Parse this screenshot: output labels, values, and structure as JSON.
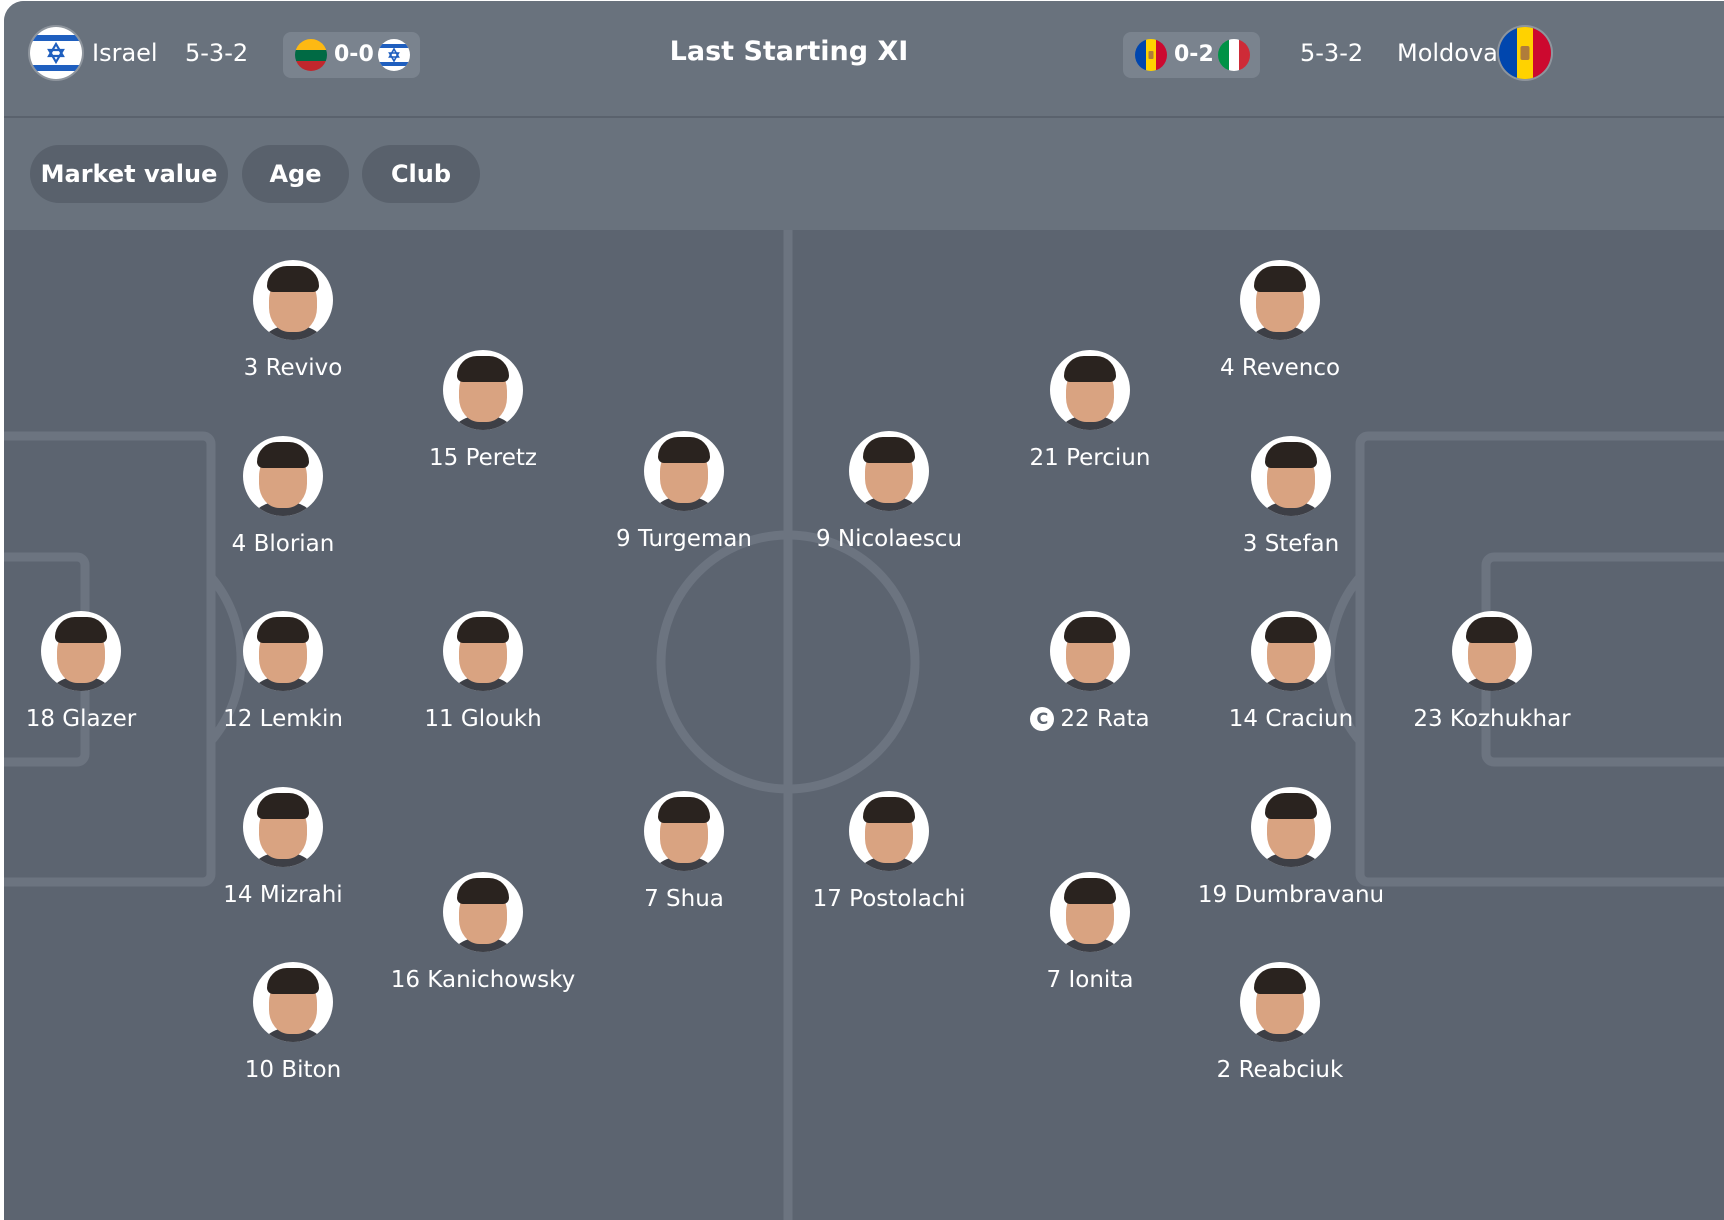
{
  "header": {
    "title": "Last Starting XI",
    "home": {
      "team": "Israel",
      "formation": "5-3-2",
      "last_match": {
        "score": "0-0",
        "left_flag": "lithuania-flag",
        "right_flag": "israel-flag"
      },
      "flag": "israel-flag"
    },
    "away": {
      "team": "Moldova",
      "formation": "5-3-2",
      "last_match": {
        "score": "0-2",
        "left_flag": "moldova-flag",
        "right_flag": "italy-flag"
      },
      "flag": "moldova-flag"
    }
  },
  "filters": [
    "Market value",
    "Age",
    "Club"
  ],
  "colors": {
    "header_bg": "#69727d",
    "pitch_bg": "#5c6470",
    "pitch_lines": "#6c7480",
    "chip_bg": "#7a838e",
    "filter_bg": "#59616c",
    "text": "#ffffff"
  },
  "home_players": [
    {
      "label": "3 Revivo"
    },
    {
      "label": "15 Peretz"
    },
    {
      "label": "4 Blorian"
    },
    {
      "label": "9 Turgeman"
    },
    {
      "label": "18 Glazer"
    },
    {
      "label": "12 Lemkin"
    },
    {
      "label": "11 Gloukh"
    },
    {
      "label": "14 Mizrahi"
    },
    {
      "label": "7 Shua"
    },
    {
      "label": "16 Kanichowsky"
    },
    {
      "label": "10 Biton"
    }
  ],
  "away_players": [
    {
      "label": "4 Revenco"
    },
    {
      "label": "21 Perciun"
    },
    {
      "label": "9 Nicolaescu"
    },
    {
      "label": "3 Stefan"
    },
    {
      "label": "22 Rata",
      "captain": true,
      "captain_badge": "C"
    },
    {
      "label": "14 Craciun"
    },
    {
      "label": "23 Kozhukhar"
    },
    {
      "label": "17 Postolachi"
    },
    {
      "label": "19 Dumbravanu"
    },
    {
      "label": "7 Ionita"
    },
    {
      "label": "2 Reabciuk"
    }
  ]
}
